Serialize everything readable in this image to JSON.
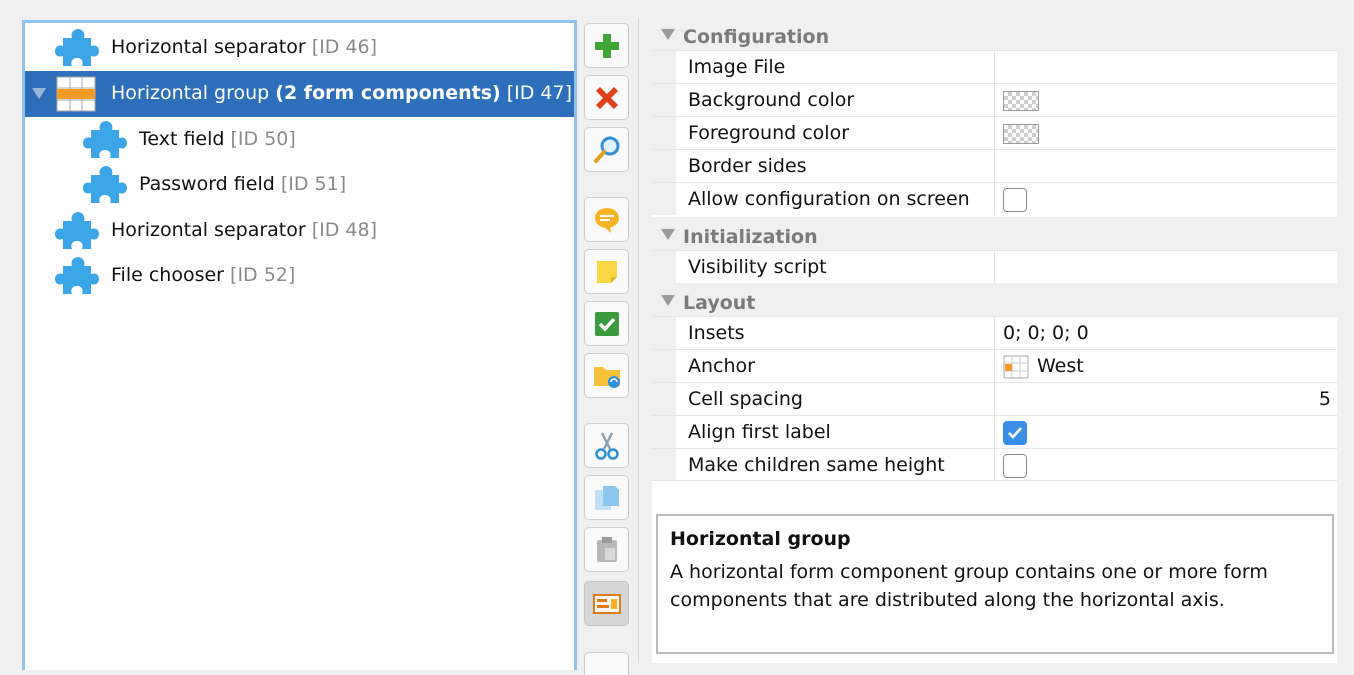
{
  "tree": {
    "items": [
      {
        "label": "Horizontal separator",
        "id": "[ID 46]"
      },
      {
        "label": "Horizontal group",
        "bold": "(2 form components)",
        "id": "[ID 47]"
      },
      {
        "label": "Text field",
        "id": "[ID 50]"
      },
      {
        "label": "Password field",
        "id": "[ID 51]"
      },
      {
        "label": "Horizontal separator",
        "id": "[ID 48]"
      },
      {
        "label": "File chooser",
        "id": "[ID 52]"
      }
    ]
  },
  "toolbar": {
    "buttons": [
      "add-icon",
      "delete-icon",
      "search-icon",
      "comment-icon",
      "note-icon",
      "check-icon",
      "folder-sync-icon",
      "cut-icon",
      "copy-icon",
      "paste-icon",
      "form-preview-icon"
    ]
  },
  "properties": {
    "sections": [
      {
        "title": "Configuration"
      },
      {
        "title": "Initialization"
      },
      {
        "title": "Layout"
      }
    ],
    "rows": {
      "image_file": {
        "name": "Image File",
        "value": ""
      },
      "background_color": {
        "name": "Background color"
      },
      "foreground_color": {
        "name": "Foreground color"
      },
      "border_sides": {
        "name": "Border sides",
        "value": ""
      },
      "allow_config": {
        "name": "Allow configuration on screen",
        "checked": false
      },
      "visibility_script": {
        "name": "Visibility script",
        "value": ""
      },
      "insets": {
        "name": "Insets",
        "value": "0; 0; 0; 0"
      },
      "anchor": {
        "name": "Anchor",
        "value": "West"
      },
      "cell_spacing": {
        "name": "Cell spacing",
        "value": "5"
      },
      "align_first_label": {
        "name": "Align first label",
        "checked": true
      },
      "same_height": {
        "name": "Make children same height",
        "checked": false
      }
    }
  },
  "description": {
    "title": "Horizontal group",
    "text": "A horizontal form component group contains one or more form components that are distributed along the horizontal axis."
  },
  "colors": {
    "selection": "#2d6fba",
    "tree_border": "#90c2ee",
    "checkbox_checked": "#3b8ee8",
    "puzzle_icon": "#3aa6e8"
  }
}
